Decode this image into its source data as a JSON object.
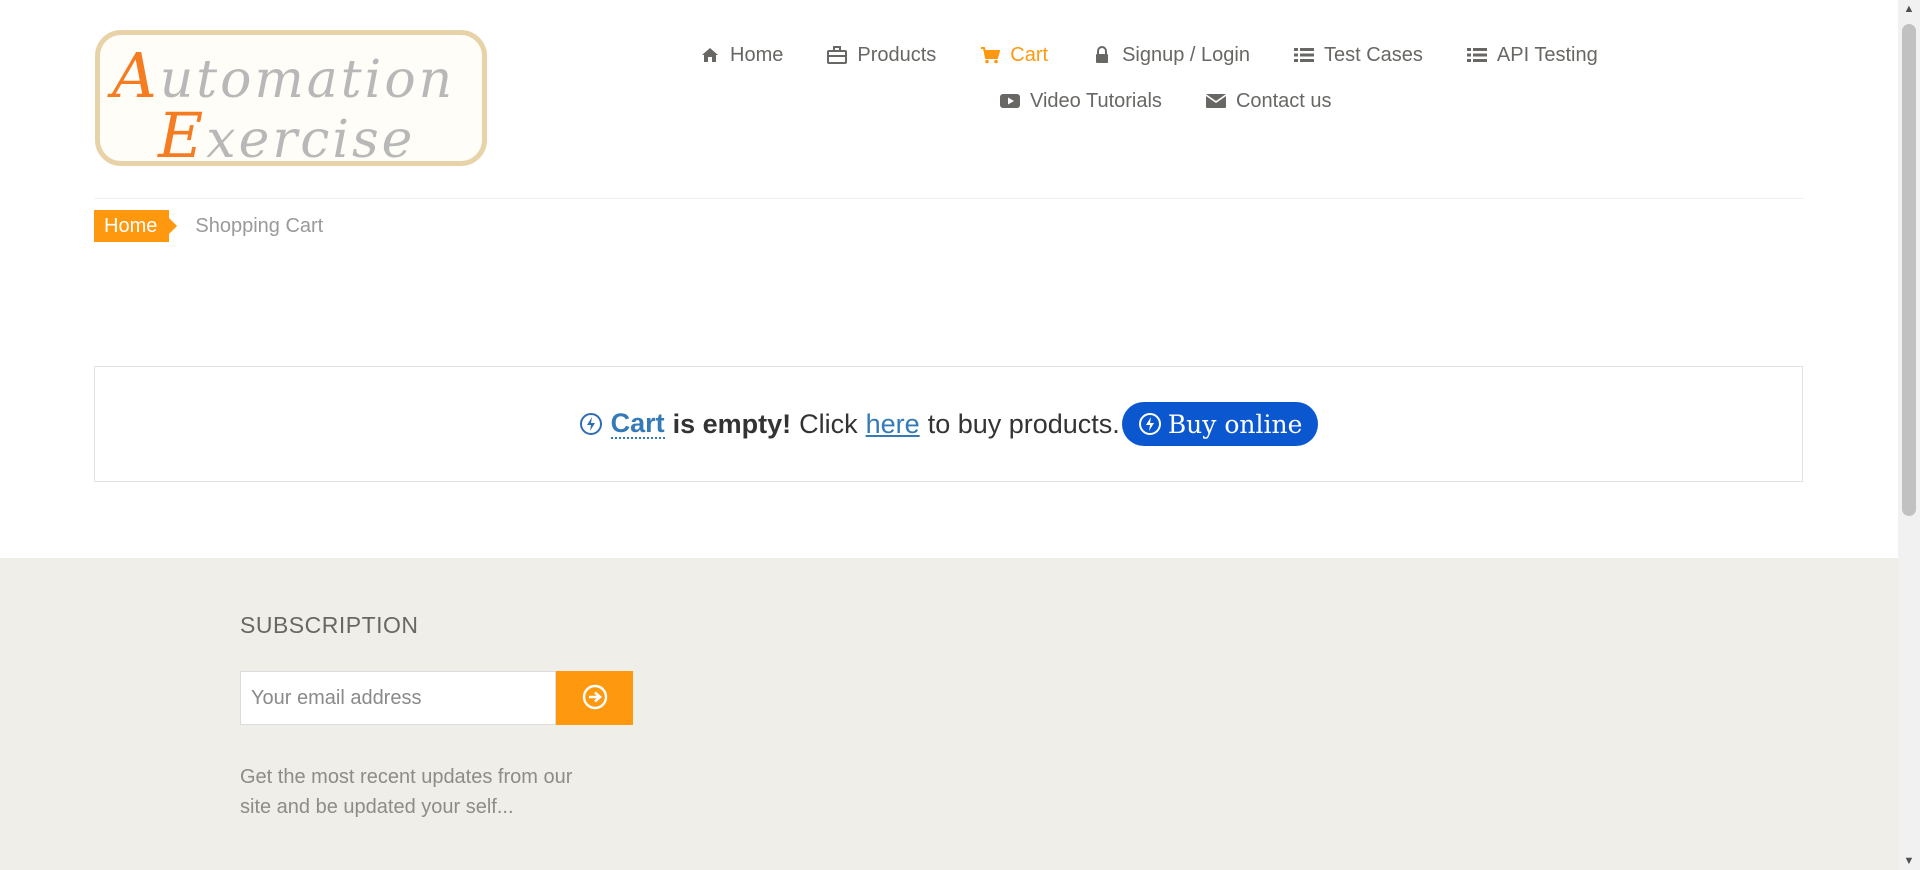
{
  "logo": {
    "line1_cap": "A",
    "line1_rest": "utomation",
    "line2_cap": "E",
    "line2_rest": "xercise"
  },
  "nav": {
    "items": [
      {
        "label": "Home",
        "icon": "home-icon"
      },
      {
        "label": "Products",
        "icon": "briefcase-icon"
      },
      {
        "label": "Cart",
        "icon": "shopping-cart-icon",
        "active": true
      },
      {
        "label": "Signup / Login",
        "icon": "lock-icon"
      },
      {
        "label": "Test Cases",
        "icon": "list-icon"
      },
      {
        "label": "API Testing",
        "icon": "list-icon"
      },
      {
        "label": "Video Tutorials",
        "icon": "youtube-play-icon"
      },
      {
        "label": "Contact us",
        "icon": "envelope-icon"
      }
    ]
  },
  "breadcrumb": {
    "home": "Home",
    "current": "Shopping Cart"
  },
  "empty_cart": {
    "cart_word": "Cart",
    "is_empty": "is empty!",
    "click": "Click",
    "here": "here",
    "to_buy": "to buy products.",
    "buy_online": "Buy online"
  },
  "footer": {
    "subscription_title": "SUBSCRIPTION",
    "email_placeholder": "Your email address",
    "description": "Get the most recent updates from our site and be updated your self..."
  },
  "colors": {
    "accent": "#fe980f",
    "link": "#337ab7",
    "buy_button": "#0b57d0",
    "footer_bg": "#efeee8"
  }
}
